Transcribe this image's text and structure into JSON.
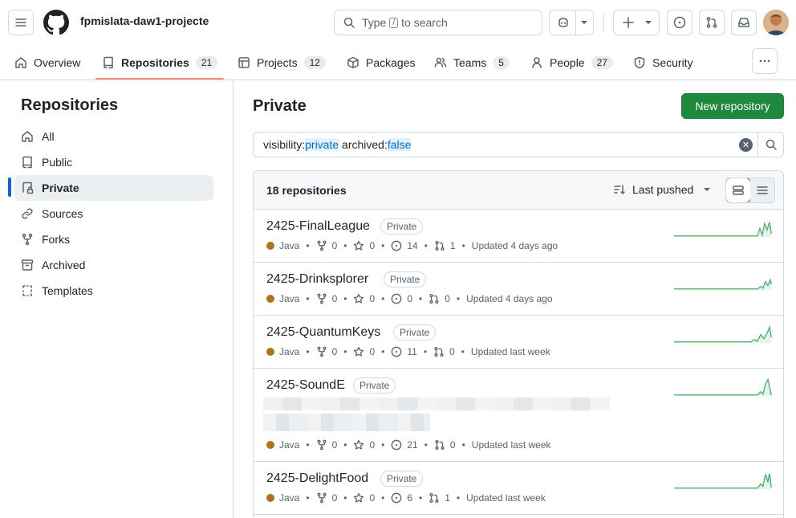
{
  "header": {
    "org_name": "fpmislata-daw1-projecte",
    "search_placeholder_before": "Type",
    "search_key": "/",
    "search_placeholder_after": "to search"
  },
  "tabs": [
    {
      "label": "Overview",
      "icon": "home-icon"
    },
    {
      "label": "Repositories",
      "count": "21",
      "icon": "repo-icon",
      "active": true
    },
    {
      "label": "Projects",
      "count": "12",
      "icon": "table-icon"
    },
    {
      "label": "Packages",
      "icon": "package-icon"
    },
    {
      "label": "Teams",
      "count": "5",
      "icon": "people-icon"
    },
    {
      "label": "People",
      "count": "27",
      "icon": "person-icon"
    },
    {
      "label": "Security",
      "icon": "shield-icon"
    }
  ],
  "sidebar": {
    "title": "Repositories",
    "items": [
      {
        "label": "All",
        "icon": "home-icon"
      },
      {
        "label": "Public",
        "icon": "repo-icon"
      },
      {
        "label": "Private",
        "icon": "lock-icon",
        "active": true
      },
      {
        "label": "Sources",
        "icon": "link-icon"
      },
      {
        "label": "Forks",
        "icon": "fork-icon"
      },
      {
        "label": "Archived",
        "icon": "archive-icon"
      },
      {
        "label": "Templates",
        "icon": "template-icon"
      }
    ]
  },
  "main": {
    "title": "Private",
    "new_button": "New repository",
    "filter": {
      "k1": "visibility:",
      "v1": "private",
      "k2": "archived:",
      "v2": "false"
    },
    "count_label": "18 repositories",
    "sort_label": "Last pushed"
  },
  "colors": {
    "accent": "#0969da",
    "primary_button": "#1f883d",
    "java": "#b07219",
    "active_tab_underline": "#fd8c73",
    "sparkline": "#2da44e"
  },
  "repos": [
    {
      "name": "2425-FinalLeague",
      "visibility": "Private",
      "language": "Java",
      "forks": "0",
      "stars": "0",
      "issues": "14",
      "prs": "1",
      "updated": "Updated 4 days ago"
    },
    {
      "name": "2425-Drinksplorer",
      "visibility": "Private",
      "language": "Java",
      "forks": "0",
      "stars": "0",
      "issues": "0",
      "prs": "0",
      "updated": "Updated 4 days ago"
    },
    {
      "name": "2425-QuantumKeys",
      "visibility": "Private",
      "language": "Java",
      "forks": "0",
      "stars": "0",
      "issues": "11",
      "prs": "0",
      "updated": "Updated last week"
    },
    {
      "name": "2425-SoundE",
      "visibility": "Private",
      "language": "Java",
      "forks": "0",
      "stars": "0",
      "issues": "21",
      "prs": "0",
      "updated": "Updated last week"
    },
    {
      "name": "2425-DelightFood",
      "visibility": "Private",
      "language": "Java",
      "forks": "0",
      "stars": "0",
      "issues": "6",
      "prs": "1",
      "updated": "Updated last week"
    }
  ]
}
